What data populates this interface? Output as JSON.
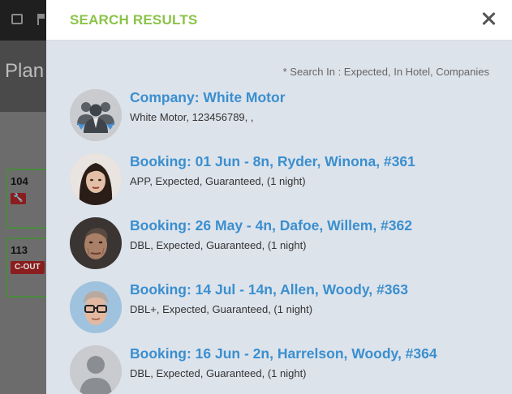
{
  "background": {
    "title": "Plan",
    "rooms": [
      {
        "number": "104",
        "badge": ""
      },
      {
        "number": "113",
        "badge": "C-OUT"
      }
    ]
  },
  "panel": {
    "title": "SEARCH RESULTS",
    "search_note": "* Search In : Expected, In Hotel, Companies",
    "results": [
      {
        "title": "Company: White Motor",
        "subtitle": "White Motor, 123456789, ,",
        "avatar_icon": "company-group-icon"
      },
      {
        "title": "Booking: 01 Jun - 8n, Ryder, Winona, #361",
        "subtitle": "APP, Expected, Guaranteed, (1 night)",
        "avatar_icon": "guest-photo"
      },
      {
        "title": "Booking: 26 May - 4n, Dafoe, Willem, #362",
        "subtitle": "DBL, Expected, Guaranteed, (1 night)",
        "avatar_icon": "guest-photo"
      },
      {
        "title": "Booking: 14 Jul - 14n, Allen, Woody, #363",
        "subtitle": "DBL+, Expected, Guaranteed, (1 night)",
        "avatar_icon": "guest-photo"
      },
      {
        "title": "Booking: 16 Jun - 2n, Harrelson, Woody, #364",
        "subtitle": "DBL, Expected, Guaranteed, (1 night)",
        "avatar_icon": "default-user-icon"
      }
    ]
  },
  "colors": {
    "title_green": "#8bc34a",
    "link_blue": "#3a8fcf",
    "panel_bg": "#dde3eb"
  }
}
